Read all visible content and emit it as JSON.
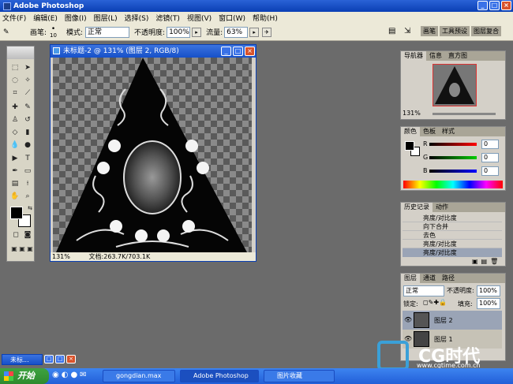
{
  "app": {
    "title": "Adobe Photoshop",
    "window_min": "_",
    "window_max": "□",
    "window_close": "×"
  },
  "menu": [
    "文件(F)",
    "编辑(E)",
    "图像(I)",
    "图层(L)",
    "选择(S)",
    "滤镜(T)",
    "视图(V)",
    "窗口(W)",
    "帮助(H)"
  ],
  "options": {
    "brush_label": "画笔:",
    "brush_size": "10",
    "mode_label": "模式:",
    "mode_value": "正常",
    "opacity_label": "不透明度:",
    "opacity_value": "100%",
    "flow_label": "流量:",
    "flow_value": "63%",
    "tabs": [
      "画笔",
      "工具预设",
      "图层复合"
    ]
  },
  "document": {
    "title": "未标题-2 @ 131% (图层 2, RGB/8)",
    "zoom": "131%",
    "info": "文档:263.7K/703.1K"
  },
  "navigator": {
    "tabs": [
      "导航器",
      "信息",
      "直方图"
    ],
    "zoom": "131%"
  },
  "color": {
    "tabs": [
      "颜色",
      "色板",
      "样式"
    ],
    "channels": [
      {
        "name": "R",
        "value": "0"
      },
      {
        "name": "G",
        "value": "0"
      },
      {
        "name": "B",
        "value": "0"
      }
    ]
  },
  "history": {
    "tabs": [
      "历史记录",
      "动作"
    ],
    "items": [
      "亮度/对比度",
      "向下合并",
      "去色",
      "亮度/对比度",
      "亮度/对比度"
    ]
  },
  "layers": {
    "tabs": [
      "图层",
      "通道",
      "路径"
    ],
    "blend_mode": "正常",
    "opacity_label": "不透明度:",
    "opacity_value": "100%",
    "lock_label": "锁定:",
    "fill_label": "填充:",
    "fill_value": "100%",
    "items": [
      "图层 2",
      "图层 1"
    ]
  },
  "taskbar": {
    "start": "开始",
    "tasks": [
      "gongdian.max",
      "Adobe Photoshop",
      "图片收藏"
    ],
    "mini_doc": "未标..."
  },
  "watermark": {
    "brand": "CG时代",
    "url": "www.cgtime.com.cn"
  }
}
